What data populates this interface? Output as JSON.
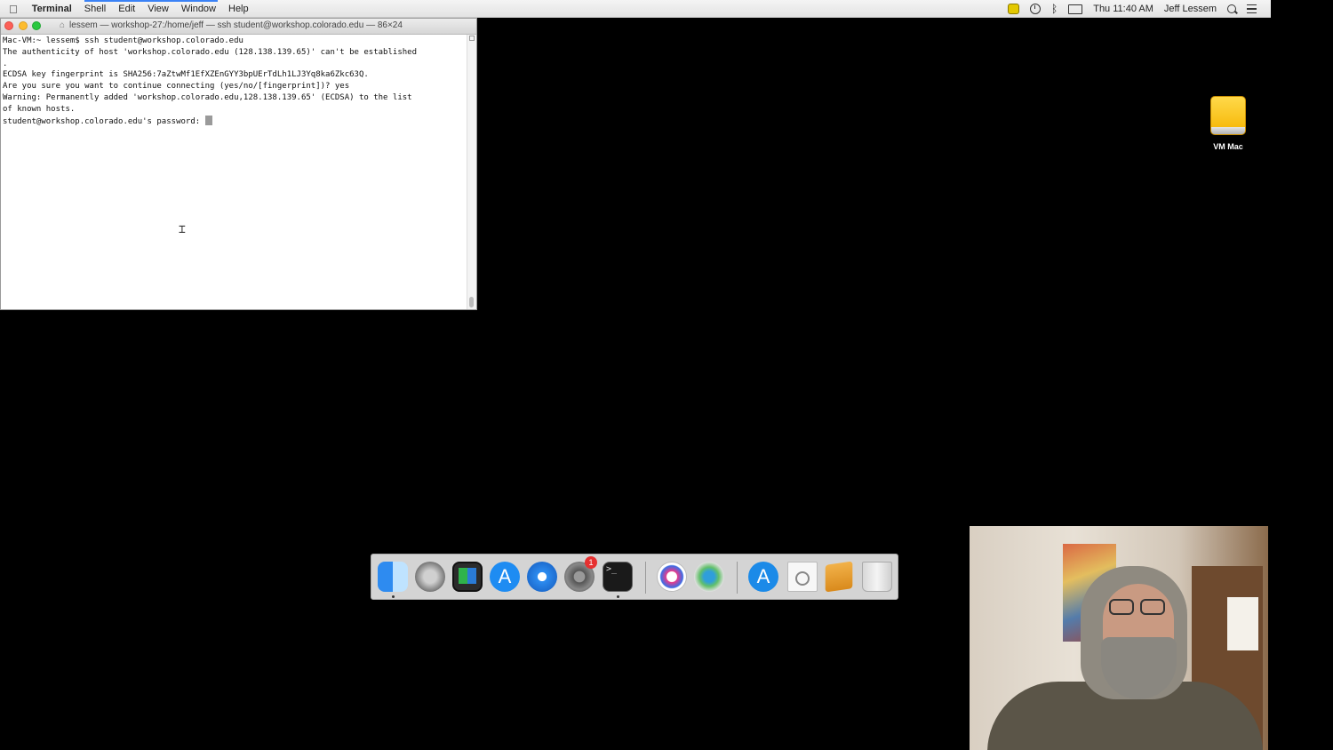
{
  "menubar": {
    "app": "Terminal",
    "items": [
      "Shell",
      "Edit",
      "View",
      "Window",
      "Help"
    ],
    "clock": "Thu 11:40 AM",
    "user": "Jeff Lessem"
  },
  "terminal": {
    "title": "lessem — workshop-27:/home/jeff — ssh student@workshop.colorado.edu — 86×24",
    "lines": [
      "Mac-VM:~ lessem$ ssh student@workshop.colorado.edu",
      "The authenticity of host 'workshop.colorado.edu (128.138.139.65)' can't be established",
      ".",
      "ECDSA key fingerprint is SHA256:7aZtwMf1EfXZEnGYY3bpUErTdLh1LJ3Yq8ka6Zkc63Q.",
      "Are you sure you want to continue connecting (yes/no/[fingerprint])? yes",
      "Warning: Permanently added 'workshop.colorado.edu,128.138.139.65' (ECDSA) to the list",
      "of known hosts."
    ],
    "prompt": "student@workshop.colorado.edu's password: "
  },
  "desktop": {
    "icons": [
      {
        "label": "VM Mac",
        "icon": "external-drive-icon"
      }
    ]
  },
  "dock": {
    "apps": [
      "finder-icon",
      "launchpad-icon",
      "photo-booth-icon",
      "app-store-icon",
      "safari-icon",
      "system-preferences-icon",
      "terminal-icon",
      "utility-icon",
      "network-icon",
      "app-store-download-icon",
      "config-document-icon",
      "package-icon",
      "trash-icon"
    ],
    "prefs_badge": "1",
    "terminal_glyph": ">_"
  }
}
